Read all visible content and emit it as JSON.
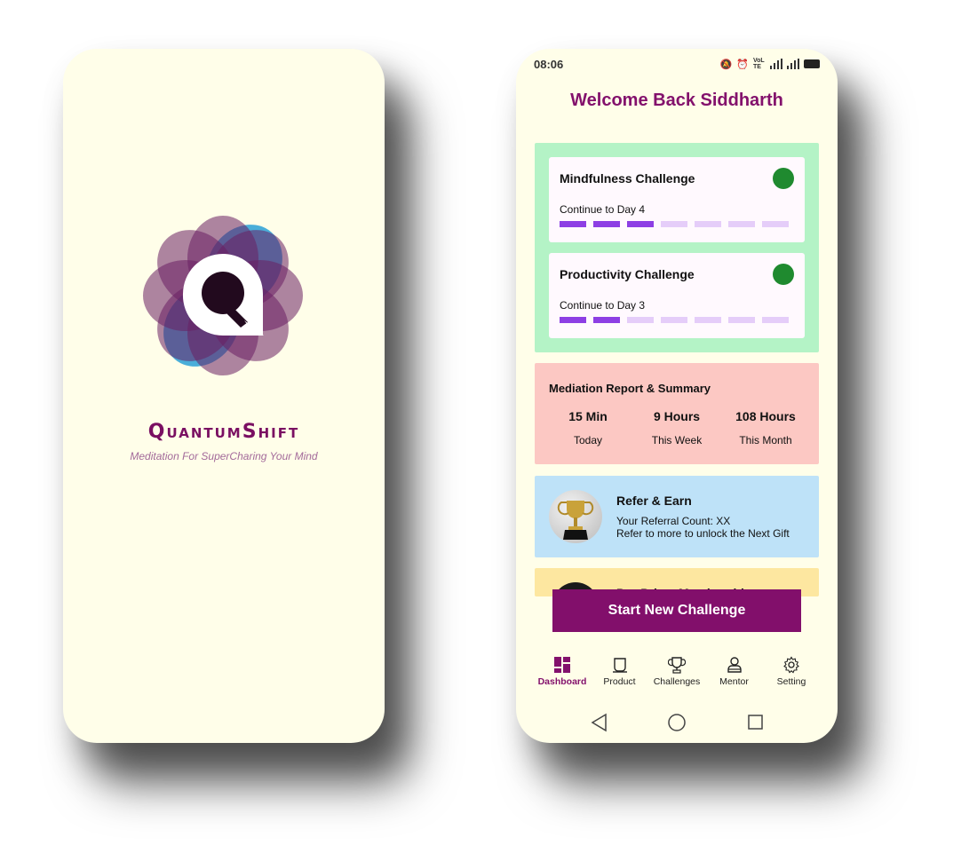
{
  "splash": {
    "brand_name": "QuantumShift",
    "tagline": "Meditation For SuperCharing Your Mind"
  },
  "status_bar": {
    "time": "08:06",
    "network_label": "VoLTE"
  },
  "dashboard": {
    "welcome": "Welcome Back Siddharth",
    "challenges": [
      {
        "title": "Mindfulness Challenge",
        "progress_text": "Continue to Day 4",
        "completed_days": 3,
        "total_days": 7,
        "status_color": "#1f8a2f"
      },
      {
        "title": "Productivity Challenge",
        "progress_text": "Continue to Day 3",
        "completed_days": 2,
        "total_days": 7,
        "status_color": "#1f8a2f"
      }
    ],
    "report": {
      "title": "Mediation Report & Summary",
      "stats": [
        {
          "value": "15 Min",
          "label": "Today"
        },
        {
          "value": "9 Hours",
          "label": "This Week"
        },
        {
          "value": "108 Hours",
          "label": "This Month"
        }
      ]
    },
    "refer": {
      "title": "Refer & Earn",
      "line1": "Your Referral Count: XX",
      "line2": "Refer to more to unlock the Next Gift"
    },
    "membership": {
      "title": "Pro Prime Membership"
    },
    "start_button": "Start New Challenge"
  },
  "bottom_nav": [
    {
      "label": "Dashboard",
      "icon": "dashboard-icon",
      "active": true
    },
    {
      "label": "Product",
      "icon": "product-icon",
      "active": false
    },
    {
      "label": "Challenges",
      "icon": "trophy-icon",
      "active": false
    },
    {
      "label": "Mentor",
      "icon": "mentor-icon",
      "active": false
    },
    {
      "label": "Setting",
      "icon": "gear-icon",
      "active": false
    }
  ],
  "colors": {
    "brand": "#83116c",
    "background": "#fffee9",
    "challenges_panel": "#b4f3c6",
    "report_panel": "#fcc8c3",
    "refer_panel": "#bee2f8",
    "membership_panel": "#fde7a0",
    "progress_done": "#8d3fe4",
    "progress_todo": "#e5cdf9"
  }
}
